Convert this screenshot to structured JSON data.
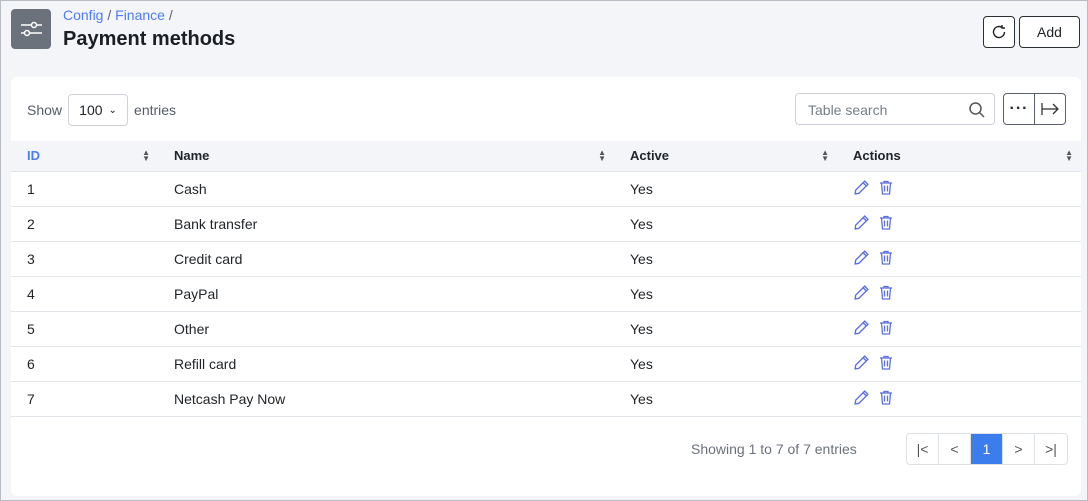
{
  "header": {
    "breadcrumb": [
      "Config",
      "Finance"
    ],
    "title": "Payment methods",
    "add_label": "Add",
    "icon": "sliders-icon"
  },
  "toolbar": {
    "show_label": "Show",
    "entries_value": "100",
    "entries_label": "entries",
    "search_placeholder": "Table search"
  },
  "table": {
    "columns": [
      "ID",
      "Name",
      "Active",
      "Actions"
    ],
    "rows": [
      [
        "1",
        "Cash",
        "Yes"
      ],
      [
        "2",
        "Bank transfer",
        "Yes"
      ],
      [
        "3",
        "Credit card",
        "Yes"
      ],
      [
        "4",
        "PayPal",
        "Yes"
      ],
      [
        "5",
        "Other",
        "Yes"
      ],
      [
        "6",
        "Refill card",
        "Yes"
      ],
      [
        "7",
        "Netcash Pay Now",
        "Yes"
      ]
    ]
  },
  "footer": {
    "info": "Showing 1 to 7 of 7 entries",
    "current_page": "1"
  },
  "colors": {
    "accent": "#3b7ded",
    "link": "#4e7cf2",
    "action_icon": "#5c6fe0"
  }
}
